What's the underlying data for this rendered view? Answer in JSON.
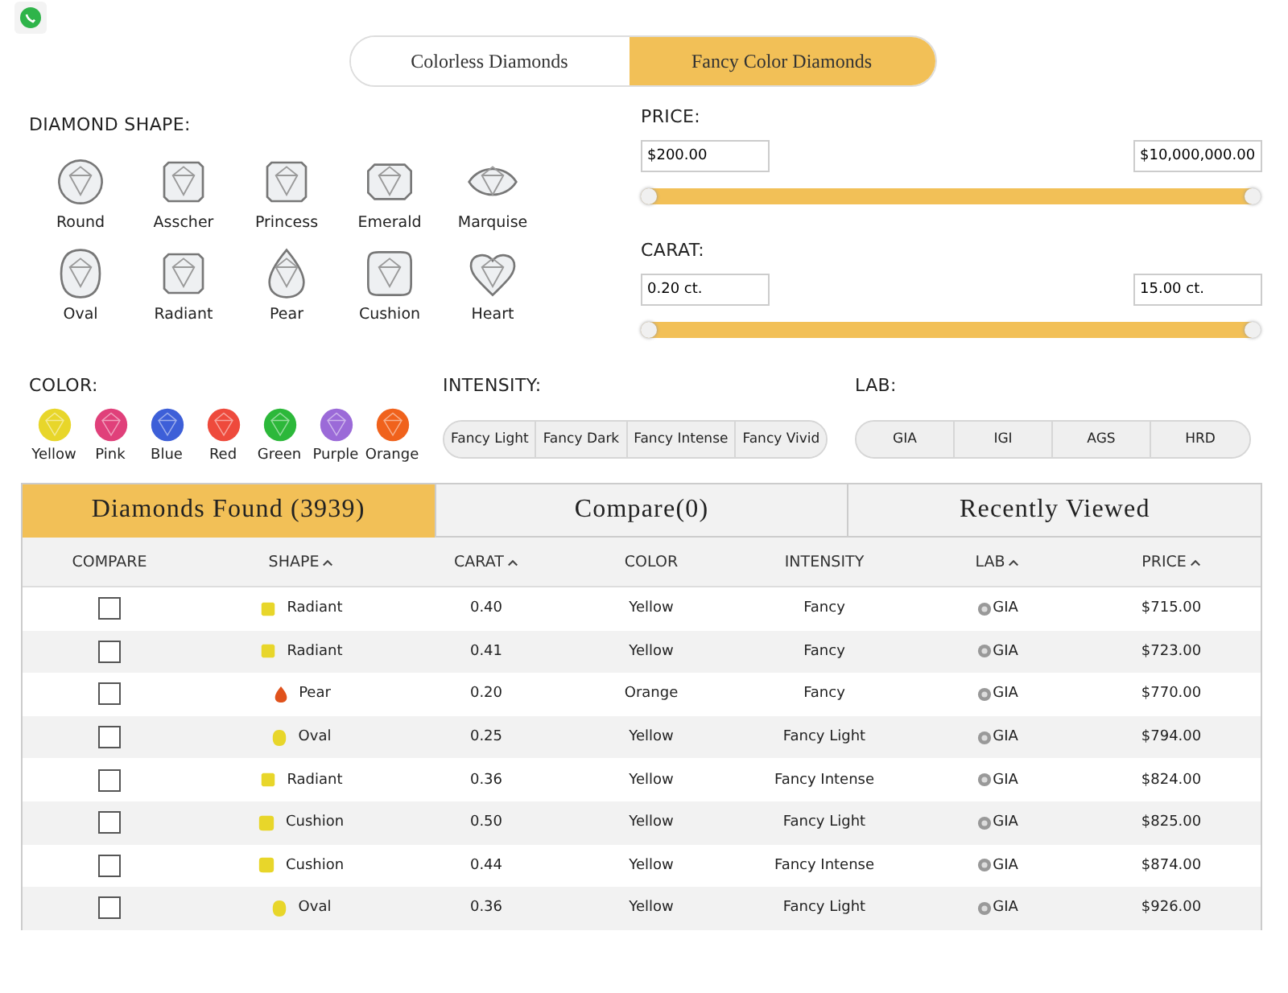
{
  "toggle": [
    {
      "label": "Colorless Diamonds",
      "selected": false
    },
    {
      "label": "Fancy Color Diamonds",
      "selected": true
    }
  ],
  "shape_filter": {
    "title": "DIAMOND SHAPE:",
    "shapes": [
      {
        "label": "Round",
        "kind": "round"
      },
      {
        "label": "Asscher",
        "kind": "square"
      },
      {
        "label": "Princess",
        "kind": "square"
      },
      {
        "label": "Emerald",
        "kind": "rect"
      },
      {
        "label": "Marquise",
        "kind": "marquise"
      },
      {
        "label": "Oval",
        "kind": "oval"
      },
      {
        "label": "Radiant",
        "kind": "square"
      },
      {
        "label": "Pear",
        "kind": "pear"
      },
      {
        "label": "Cushion",
        "kind": "cushion"
      },
      {
        "label": "Heart",
        "kind": "heart"
      }
    ]
  },
  "price": {
    "title": "PRICE:",
    "min": "$200.00",
    "max": "$10,000,000.00",
    "level": 1
  },
  "carat": {
    "title": "CARAT:",
    "min": "0.20 ct.",
    "max": "15.00 ct.",
    "level": 1
  },
  "color_filter": {
    "title": "COLOR:",
    "colors": [
      {
        "label": "Yellow",
        "color": "#e8d62a"
      },
      {
        "label": "Pink",
        "color": "#e0407a"
      },
      {
        "label": "Blue",
        "color": "#3d5fd8"
      },
      {
        "label": "Red",
        "color": "#ee4a3c"
      },
      {
        "label": "Green",
        "color": "#2cb83a"
      },
      {
        "label": "Purple",
        "color": "#9b6ad8"
      },
      {
        "label": "Orange",
        "color": "#f0621c"
      }
    ]
  },
  "intensity_filter": {
    "title": "INTENSITY:",
    "options": [
      "Fancy Light",
      "Fancy Dark",
      "Fancy Intense",
      "Fancy Vivid"
    ]
  },
  "lab_filter": {
    "title": "LAB:",
    "options": [
      "GIA",
      "IGI",
      "AGS",
      "HRD"
    ]
  },
  "result_tabs": [
    {
      "label": "Diamonds Found (3939)",
      "selected": true
    },
    {
      "label": "Compare(0)",
      "selected": false
    },
    {
      "label": "Recently Viewed",
      "selected": false
    }
  ],
  "table": {
    "columns": [
      {
        "label": "COMPARE",
        "sortable": false
      },
      {
        "label": "SHAPE",
        "sortable": true
      },
      {
        "label": "CARAT",
        "sortable": true
      },
      {
        "label": "COLOR",
        "sortable": false
      },
      {
        "label": "INTENSITY",
        "sortable": false
      },
      {
        "label": "LAB",
        "sortable": true
      },
      {
        "label": "PRICE",
        "sortable": true
      }
    ],
    "rows": [
      {
        "checked": false,
        "shape": "Radiant",
        "kind": "square",
        "color": "#e8d62a",
        "carat": "0.40",
        "color_name": "Yellow",
        "intensity": "Fancy",
        "lab": "GIA",
        "price": "$715.00"
      },
      {
        "checked": false,
        "shape": "Radiant",
        "kind": "square",
        "color": "#e8d62a",
        "carat": "0.41",
        "color_name": "Yellow",
        "intensity": "Fancy",
        "lab": "GIA",
        "price": "$723.00"
      },
      {
        "checked": false,
        "shape": "Pear",
        "kind": "pear",
        "color": "#e0521c",
        "carat": "0.20",
        "color_name": "Orange",
        "intensity": "Fancy",
        "lab": "GIA",
        "price": "$770.00"
      },
      {
        "checked": false,
        "shape": "Oval",
        "kind": "oval",
        "color": "#e8d62a",
        "carat": "0.25",
        "color_name": "Yellow",
        "intensity": "Fancy Light",
        "lab": "GIA",
        "price": "$794.00"
      },
      {
        "checked": false,
        "shape": "Radiant",
        "kind": "square",
        "color": "#e8d62a",
        "carat": "0.36",
        "color_name": "Yellow",
        "intensity": "Fancy Intense",
        "lab": "GIA",
        "price": "$824.00"
      },
      {
        "checked": false,
        "shape": "Cushion",
        "kind": "cushion",
        "color": "#e8d62a",
        "carat": "0.50",
        "color_name": "Yellow",
        "intensity": "Fancy Light",
        "lab": "GIA",
        "price": "$825.00"
      },
      {
        "checked": false,
        "shape": "Cushion",
        "kind": "cushion",
        "color": "#e8d62a",
        "carat": "0.44",
        "color_name": "Yellow",
        "intensity": "Fancy Intense",
        "lab": "GIA",
        "price": "$874.00"
      },
      {
        "checked": false,
        "shape": "Oval",
        "kind": "oval",
        "color": "#e8d62a",
        "carat": "0.36",
        "color_name": "Yellow",
        "intensity": "Fancy Light",
        "lab": "GIA",
        "price": "$926.00"
      }
    ]
  }
}
